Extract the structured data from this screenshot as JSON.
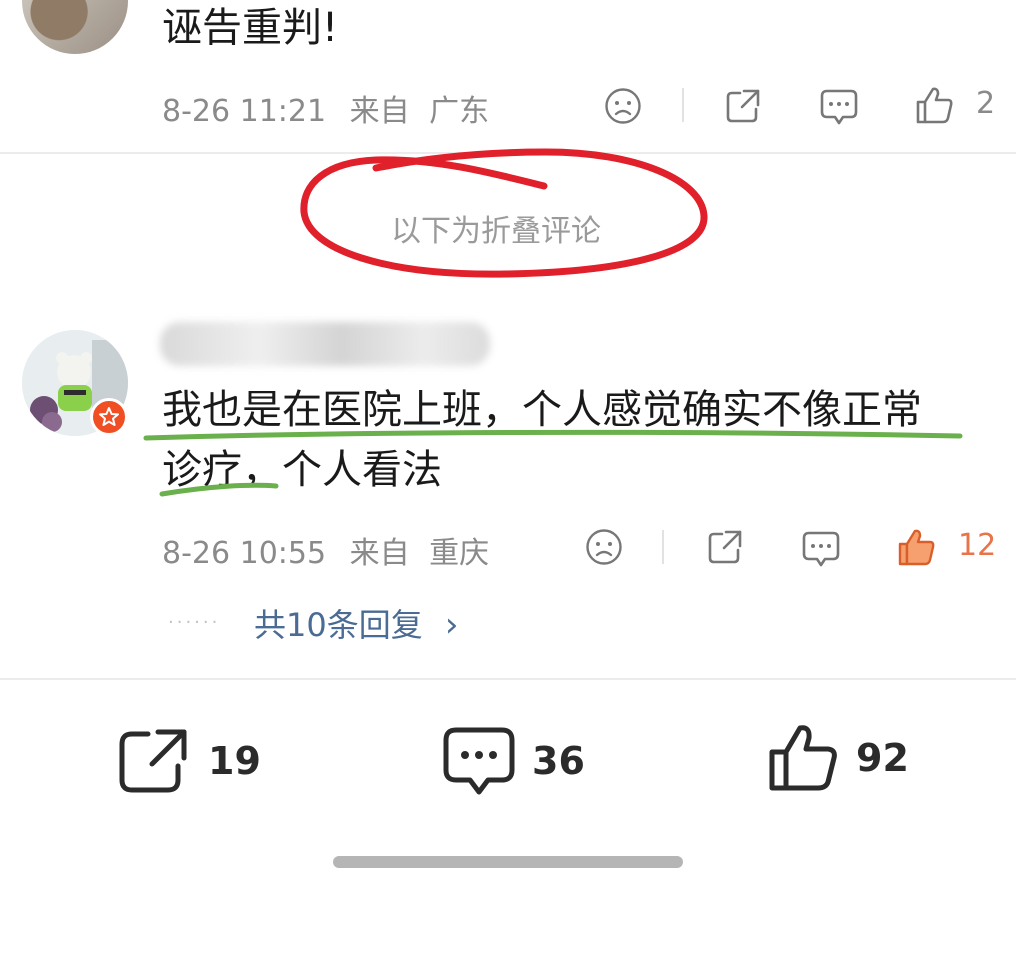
{
  "comment_top": {
    "text": "诬告重判!",
    "time": "8-26 11:21",
    "source_prefix": "来自",
    "location": "广东",
    "like_count": "2"
  },
  "folded_notice": "以下为折叠评论",
  "comment_main": {
    "line1": "我也是在医院上班，个人感觉确实不像正常",
    "line2": "诊疗，个人看法",
    "time": "8-26 10:55",
    "source_prefix": "来自",
    "location": "重庆",
    "like_count": "12",
    "replies_dots": "······",
    "replies_label": "共10条回复",
    "replies_chevron": "›"
  },
  "bottom_bar": {
    "share_count": "19",
    "comment_count": "36",
    "like_count": "92"
  },
  "colors": {
    "annotation_red": "#e0202a",
    "annotation_green": "#6ab04c",
    "like_active": "#e8744a",
    "reply_link": "#4a6b94"
  },
  "icons": [
    "sad-face-icon",
    "share-icon",
    "comment-icon",
    "thumb-up-icon"
  ]
}
